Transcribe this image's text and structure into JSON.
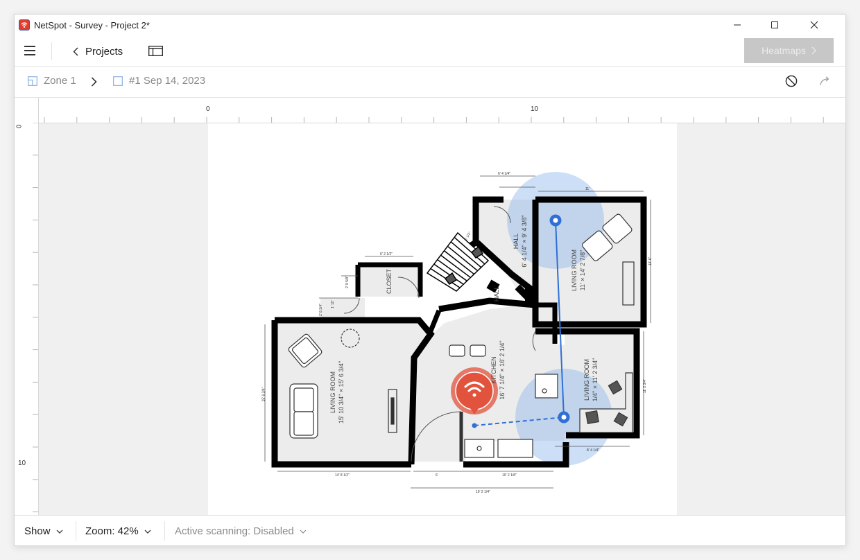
{
  "window": {
    "title": "NetSpot - Survey - Project 2*"
  },
  "toolbar": {
    "projects_label": "Projects",
    "heatmaps_label": "Heatmaps"
  },
  "breadcrumb": {
    "zone_label": "Zone 1",
    "survey_label": "#1 Sep 14, 2023"
  },
  "ruler": {
    "top_marks": [
      "0",
      "10"
    ],
    "left_marks": [
      "0",
      "10"
    ]
  },
  "floorplan": {
    "rooms": [
      {
        "name": "LIVING ROOM",
        "size": "15' 10 3/4\" × 15' 6 3/4\""
      },
      {
        "name": "KITCHEN",
        "size": "16' 7 1/4\" × 16' 2 1/4\""
      },
      {
        "name": "CLOSET",
        "size": ""
      },
      {
        "name": "HALL",
        "size": ""
      },
      {
        "name": "HALL",
        "size": "6' 4 1/4\" × 9' 4 3/8\""
      },
      {
        "name": "LIVING ROOM",
        "size": "11' × 14' 2 7/8\""
      },
      {
        "name": "LIVING ROOM",
        "size": "1/4\" × 11' 2 3/4\""
      }
    ],
    "dimensions": [
      "6' 4 1/4\"",
      "6' 2 1/2\"",
      "11'",
      "13' 6\"",
      "15' 6 3/4\"",
      "14' 8 1/2\"",
      "6'",
      "10' 2 1/8\"",
      "16' 2 1/4\"",
      "8' 4 1/4\"",
      "11' 2 3/4\"",
      "2' 8 5/8\"",
      "1' 11\"",
      "2' 8 3/4\"",
      "5' 1/2\""
    ]
  },
  "colors": {
    "wall": "#000000",
    "floor": "#ececec",
    "coverage": "#8fb8ec",
    "path": "#2f6fd6",
    "access_point": "#e2533d",
    "disabled_button": "#c7c7c7"
  },
  "statusbar": {
    "show_label": "Show",
    "zoom_label": "Zoom: 42%",
    "scanning_label": "Active scanning: Disabled"
  }
}
